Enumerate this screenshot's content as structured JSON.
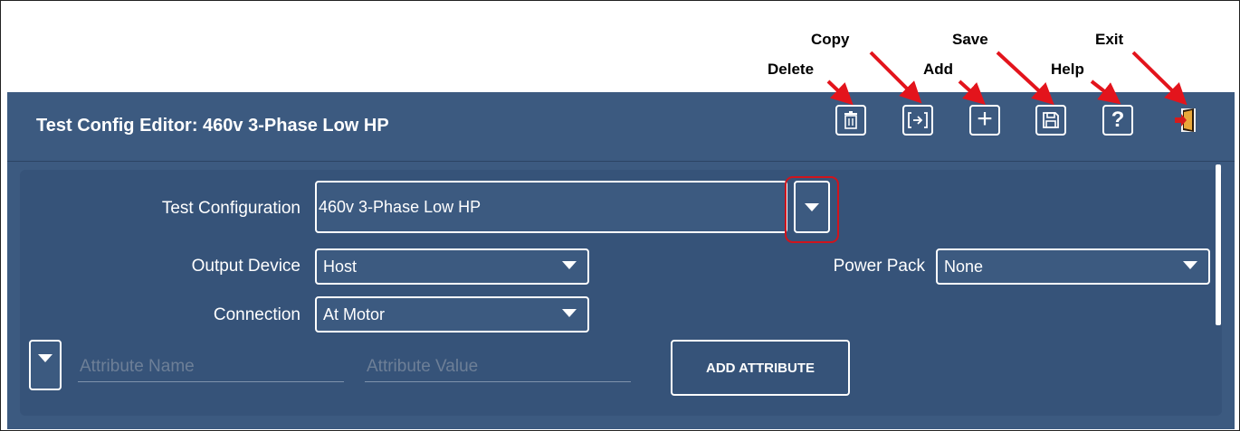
{
  "annotations": {
    "copy": "Copy",
    "delete": "Delete",
    "save": "Save",
    "add": "Add",
    "exit": "Exit",
    "help": "Help"
  },
  "header": {
    "title": "Test Config Editor: 460v 3-Phase Low HP"
  },
  "toolbar": {
    "icons": [
      "trash-icon",
      "copy-icon",
      "plus-icon",
      "save-icon",
      "help-icon",
      "exit-icon"
    ],
    "add_glyph": "+",
    "help_glyph": "?"
  },
  "form": {
    "test_configuration_label": "Test Configuration",
    "test_configuration_value": "460v 3-Phase Low HP",
    "output_device_label": "Output Device",
    "output_device_value": "Host",
    "power_pack_label": "Power Pack",
    "power_pack_value": "None",
    "connection_label": "Connection",
    "connection_value": "At Motor",
    "attribute_name_placeholder": "Attribute Name",
    "attribute_value_placeholder": "Attribute Value",
    "add_attribute_label": "ADD ATTRIBUTE"
  },
  "colors": {
    "panel": "#3c5a80",
    "content": "#365379",
    "highlight": "#d0141c",
    "arrow": "#e3141c"
  }
}
